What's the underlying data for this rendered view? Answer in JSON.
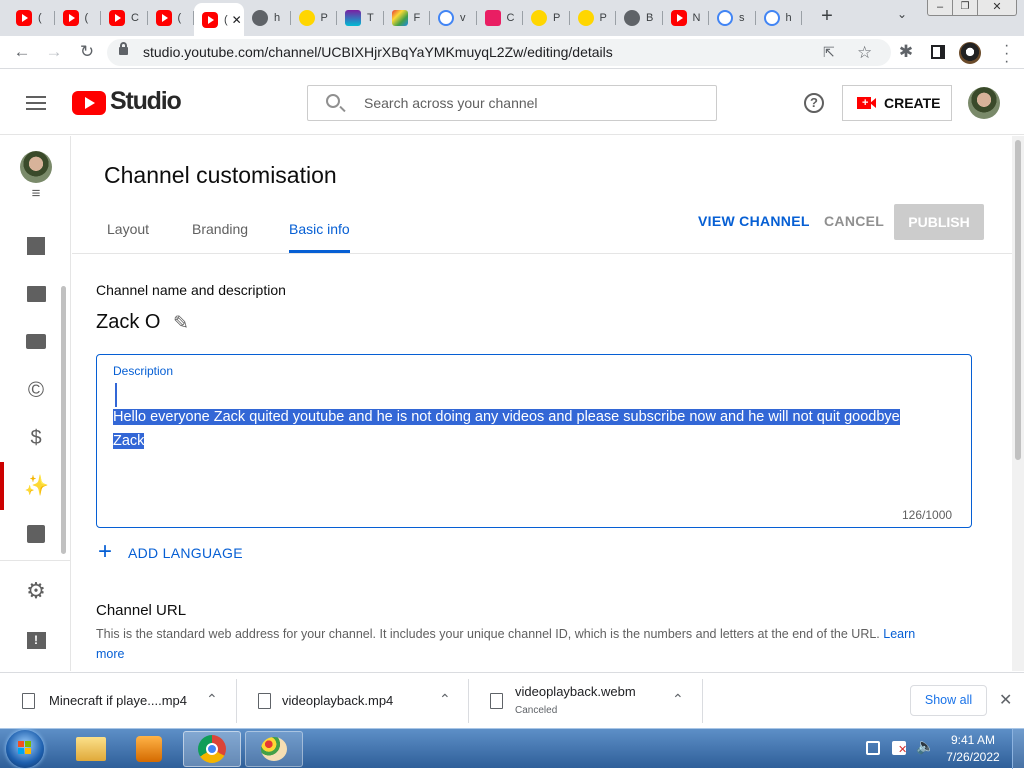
{
  "browser": {
    "tabs": [
      {
        "label": "(",
        "favicon": "youtube"
      },
      {
        "label": "(",
        "favicon": "youtube"
      },
      {
        "label": "C",
        "favicon": "youtube"
      },
      {
        "label": "(",
        "favicon": "youtube"
      },
      {
        "label": "(",
        "favicon": "youtube",
        "active": true
      },
      {
        "label": "h",
        "favicon": "globe"
      },
      {
        "label": "P",
        "favicon": "smiley"
      },
      {
        "label": "T",
        "favicon": "tt"
      },
      {
        "label": "F",
        "favicon": "paint"
      },
      {
        "label": "v",
        "favicon": "google"
      },
      {
        "label": "C",
        "favicon": "pink"
      },
      {
        "label": "P",
        "favicon": "smiley"
      },
      {
        "label": "P",
        "favicon": "smiley"
      },
      {
        "label": "B",
        "favicon": "globe"
      },
      {
        "label": "N",
        "favicon": "youtube"
      },
      {
        "label": "s",
        "favicon": "google"
      },
      {
        "label": "h",
        "favicon": "google"
      }
    ],
    "new_tab": "+",
    "url": "studio.youtube.com/channel/UCBIXHjrXBqYaYMKmuyqL2Zw/editing/details"
  },
  "header": {
    "logo_text": "Studio",
    "search_placeholder": "Search across your channel",
    "create_label": "CREATE"
  },
  "page": {
    "title": "Channel customisation",
    "tabs": [
      "Layout",
      "Branding",
      "Basic info"
    ],
    "active_tab": "Basic info",
    "view_channel": "VIEW CHANNEL",
    "cancel": "CANCEL",
    "publish": "PUBLISH"
  },
  "basic_info": {
    "section_title": "Channel name and description",
    "channel_name": "Zack O",
    "description_label": "Description",
    "description_text": "Hello everyone Zack quited youtube and he is not doing any videos and please subscribe now and he will not quit goodbye Zack",
    "char_count": "126/1000",
    "add_language": "ADD LANGUAGE",
    "url_title": "Channel URL",
    "url_desc": "This is the standard web address for your channel. It includes your unique channel ID, which is the numbers and letters at the end of the URL.",
    "learn_more": "Learn more"
  },
  "downloads": {
    "items": [
      {
        "name": "Minecraft if playe....mp4",
        "status": ""
      },
      {
        "name": "videoplayback.mp4",
        "status": ""
      },
      {
        "name": "videoplayback.webm",
        "status": "Canceled"
      }
    ],
    "show_all": "Show all"
  },
  "taskbar": {
    "time": "9:41 AM",
    "date": "7/26/2022"
  },
  "colors": {
    "accent_blue": "#065fd4",
    "youtube_red": "#ff0000",
    "selection": "#3367d6"
  }
}
